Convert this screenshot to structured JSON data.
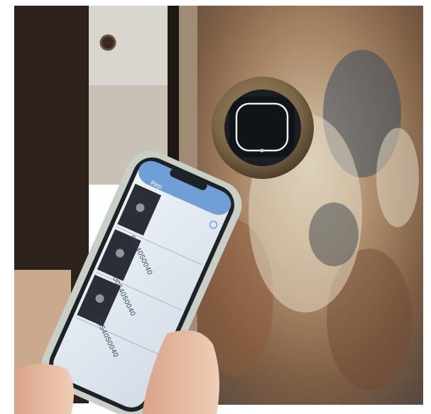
{
  "phone_screen": {
    "header_title": "Rep",
    "devices": [
      {
        "id_text": "0054050040",
        "thumbnail_icon": "lock-thumbnail-icon"
      },
      {
        "id_text": "0054050040",
        "thumbnail_icon": "lock-thumbnail-icon"
      },
      {
        "id_text": "0054050040",
        "thumbnail_icon": "lock-thumbnail-icon"
      }
    ],
    "header_icons": [
      "back-icon",
      "info-icon"
    ]
  },
  "colors": {
    "dark_wood": "#2d211b",
    "granite_cream": "#d8cbb4",
    "granite_rust": "#8a5a3a",
    "granite_blue": "#3d4d5e",
    "bronze_ring": "#7a6647",
    "reader_face": "#101419",
    "phone_case": "#c8cfc6",
    "phone_screen": "#dfe7f0",
    "skin": "#e5b9a1"
  }
}
